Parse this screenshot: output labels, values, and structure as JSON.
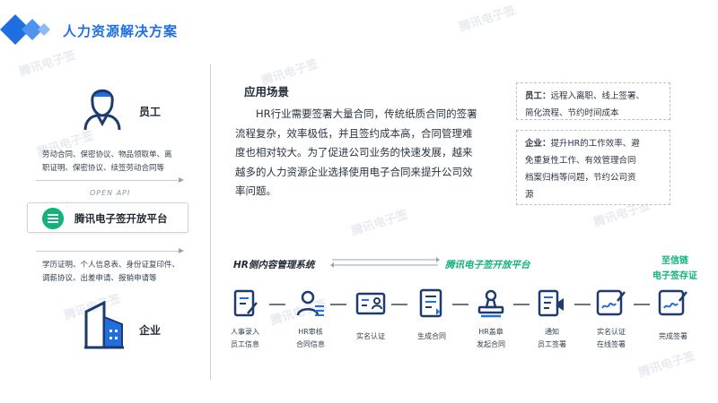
{
  "header": {
    "title": "人力资源解决方案"
  },
  "watermark": "腾讯电子签",
  "colors": {
    "brand_blue": "#1f6fe0",
    "accent_green": "#12b37b",
    "icon_navy": "#1e3a6e"
  },
  "left": {
    "employee": {
      "label": "员工",
      "icon": "employee-icon",
      "docs_line1": "劳动合同、保密协议、物品领取单、离",
      "docs_line2": "职证明、保密协议、续签劳动合同等"
    },
    "api_label": "OPEN API",
    "platform": {
      "label": "腾讯电子签开放平台",
      "icon": "platform-logo-icon"
    },
    "enterprise": {
      "label": "企业",
      "icon": "building-icon",
      "docs_line1": "学历证明、个人信息表、身份证复印件、",
      "docs_line2": "调薪协议、出差申请、报销申请等"
    }
  },
  "scene": {
    "title": "应用场景",
    "body": "HR行业需要签署大量合同，传统纸质合同的签署流程复杂，效率极低，并且签约成本高，合同管理难度也相对较大。为了促进公司业务的快速发展，越来越多的人力资源企业选择使用电子合同来提升公司效率问题。"
  },
  "notes": {
    "employee": {
      "label": "员工：",
      "line1": "远程入离职、线上签署、",
      "line2": "简化流程、节约时间成本"
    },
    "enterprise": {
      "label": "企业：",
      "line1": "提升HR的工作效率、避",
      "line2": "免重复性工作、有效管理合同",
      "line3": "档案归档等问题，节约公司资",
      "line4": "源"
    }
  },
  "flow": {
    "hr_system": "HR侧内容管理系统",
    "platform": "腾讯电子签开放平台",
    "cert_line1": "至信链",
    "cert_line2": "电子签存证",
    "steps": [
      {
        "icon": "entry-form-icon",
        "line1": "人事录入",
        "line2": "员工信息"
      },
      {
        "icon": "review-person-icon",
        "line1": "HR审核",
        "line2": "合同信息"
      },
      {
        "icon": "id-card-icon",
        "line1": "实名认证",
        "line2": ""
      },
      {
        "icon": "contract-doc-icon",
        "line1": "生成合同",
        "line2": ""
      },
      {
        "icon": "seal-stamp-icon",
        "line1": "HR盖章",
        "line2": "发起合同"
      },
      {
        "icon": "notify-doc-icon",
        "line1": "通知",
        "line2": "员工签署"
      },
      {
        "icon": "sign-pen-icon",
        "line1": "实名认证",
        "line2": "在线签署"
      },
      {
        "icon": "complete-sign-icon",
        "line1": "完成签署",
        "line2": ""
      }
    ]
  }
}
